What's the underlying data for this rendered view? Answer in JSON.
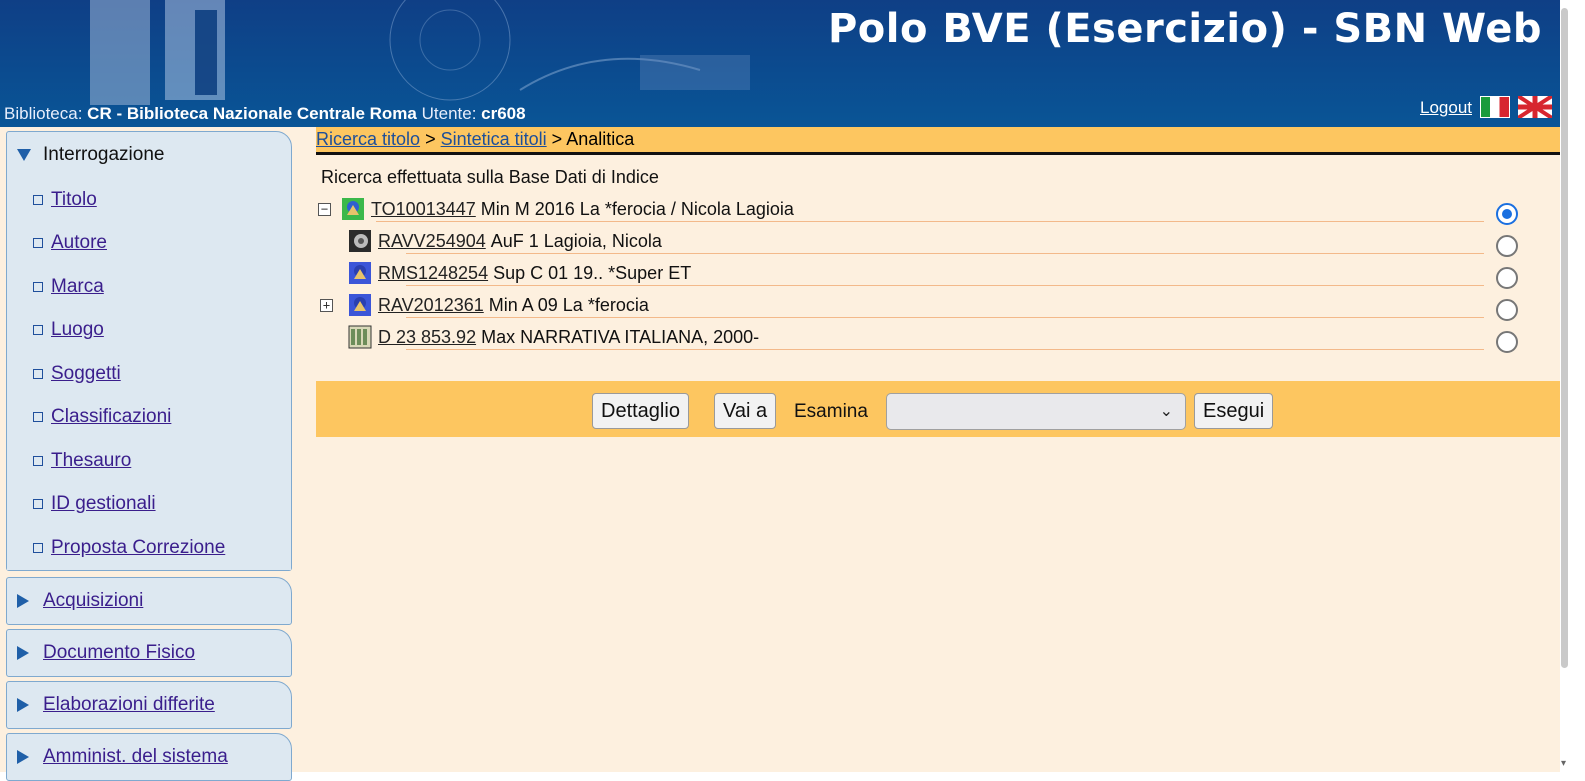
{
  "header": {
    "app_title": "Polo BVE (Esercizio) - SBN Web",
    "library_label": "Biblioteca:",
    "library_code": "CR",
    "library_name": "- Biblioteca Nazionale Centrale Roma",
    "user_label": "Utente:",
    "user_id": "cr608",
    "logout": "Logout",
    "flags": [
      "flag-italy-icon",
      "flag-uk-icon"
    ]
  },
  "sidebar": {
    "sections": [
      {
        "label": "Interrogazione",
        "expanded": true,
        "items": [
          {
            "label": "Titolo"
          },
          {
            "label": "Autore"
          },
          {
            "label": "Marca"
          },
          {
            "label": "Luogo"
          },
          {
            "label": "Soggetti"
          },
          {
            "label": "Classificazioni"
          },
          {
            "label": "Thesauro"
          },
          {
            "label": "ID gestionali"
          },
          {
            "label": "Proposta Correzione"
          }
        ]
      },
      {
        "label": "Acquisizioni",
        "expanded": false
      },
      {
        "label": "Documento Fisico",
        "expanded": false
      },
      {
        "label": "Elaborazioni differite",
        "expanded": false
      },
      {
        "label": "Amminist. del sistema",
        "expanded": false
      }
    ]
  },
  "breadcrumb": {
    "items": [
      {
        "label": "Ricerca titolo",
        "link": true
      },
      {
        "label": "Sintetica titoli",
        "link": true
      },
      {
        "label": "Analitica",
        "link": false
      }
    ],
    "separator": ">"
  },
  "main": {
    "search_note": "Ricerca effettuata sulla Base Dati di Indice",
    "tree": [
      {
        "toggle": "−",
        "icon": "title-record-icon",
        "id": "TO10013447",
        "text": "Min M 2016 La *ferocia / Nicola Lagioia",
        "selected": true
      },
      {
        "toggle": "",
        "icon": "author-record-icon",
        "id": "RAVV254904",
        "text": "AuF 1 Lagioia, Nicola",
        "selected": false
      },
      {
        "toggle": "",
        "icon": "title-record-icon",
        "id": "RMS1248254",
        "text": "Sup C 01 19.. *Super ET",
        "selected": false
      },
      {
        "toggle": "+",
        "icon": "title-record-icon",
        "id": "RAV2012361",
        "text": "Min A 09 La *ferocia",
        "selected": false
      },
      {
        "toggle": "",
        "icon": "classification-record-icon",
        "id": "D 23 853.92",
        "text": "Max NARRATIVA ITALIANA, 2000-",
        "selected": false
      }
    ],
    "actions": {
      "dettaglio": "Dettaglio",
      "vai_a": "Vai a",
      "esamina_label": "Esamina",
      "esamina_value": "",
      "esegui": "Esegui"
    }
  },
  "colors": {
    "header_blue": "#0b4b8f",
    "breadcrumb_bar": "#fdc660",
    "content_bg": "#fdf0df",
    "menu_bg": "#dde8f1"
  }
}
